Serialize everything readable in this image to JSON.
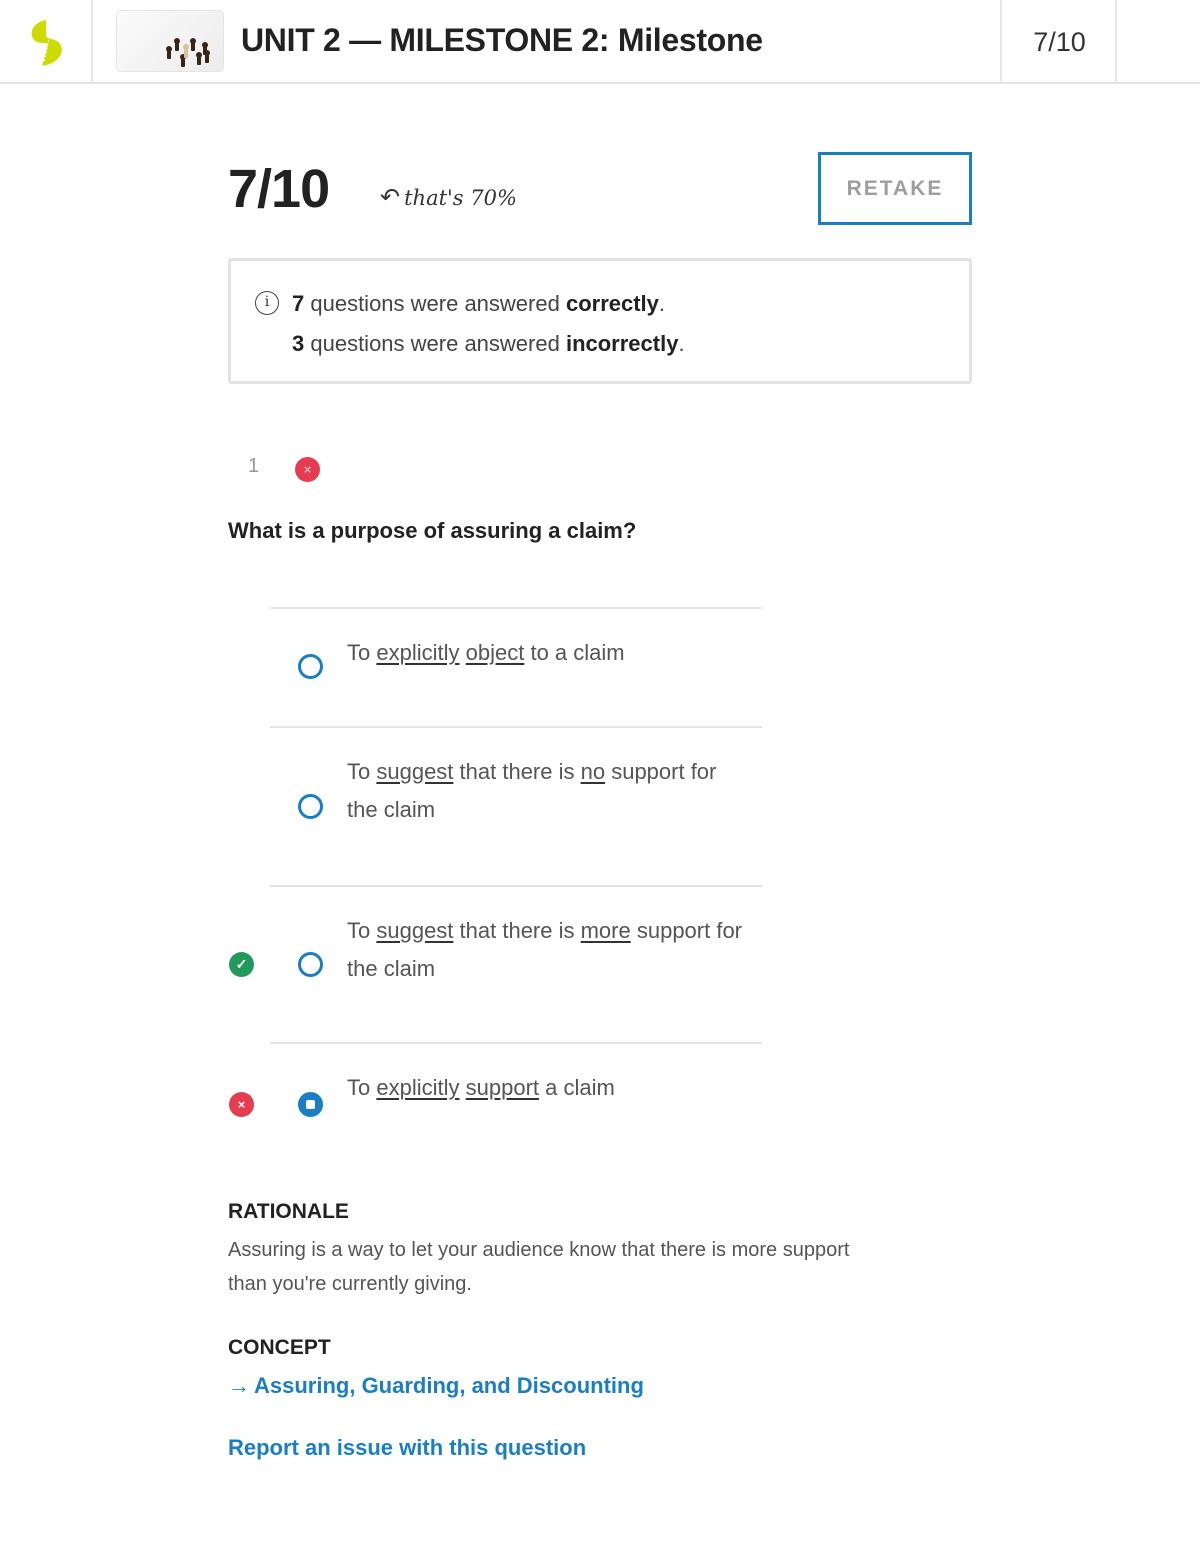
{
  "header": {
    "title": "UNIT 2 — MILESTONE 2: Milestone",
    "score": "7/10",
    "logo_color": "#cddc00",
    "thumbnail": "chess-pawns-thumbnail"
  },
  "result": {
    "score": "7/10",
    "note_arrow": "↶",
    "note": "that's 70%",
    "percent": 70,
    "retake_label": "RETAKE"
  },
  "summary": {
    "correct_count": "7",
    "correct_text": " questions were answered ",
    "correct_word": "correctly",
    "incorrect_count": "3",
    "incorrect_text": " questions were answered ",
    "incorrect_word": "incorrectly",
    "period": "."
  },
  "question": {
    "number": "1",
    "status": "incorrect",
    "text": "What is a purpose of assuring a claim?",
    "options": [
      {
        "parts": [
          {
            "t": "To ",
            "u": false
          },
          {
            "t": "explicitly",
            "u": true
          },
          {
            "t": " ",
            "u": false
          },
          {
            "t": "object",
            "u": true
          },
          {
            "t": " to a claim",
            "u": false
          }
        ],
        "selected": false,
        "marker": null
      },
      {
        "parts": [
          {
            "t": "To ",
            "u": false
          },
          {
            "t": "suggest",
            "u": true
          },
          {
            "t": " that there is ",
            "u": false
          },
          {
            "t": "no",
            "u": true
          },
          {
            "t": " support for the claim",
            "u": false
          }
        ],
        "selected": false,
        "marker": null
      },
      {
        "parts": [
          {
            "t": "To ",
            "u": false
          },
          {
            "t": "suggest",
            "u": true
          },
          {
            "t": " that there is ",
            "u": false
          },
          {
            "t": "more",
            "u": true
          },
          {
            "t": " support for the claim",
            "u": false
          }
        ],
        "selected": false,
        "marker": "correct"
      },
      {
        "parts": [
          {
            "t": "To ",
            "u": false
          },
          {
            "t": "explicitly",
            "u": true
          },
          {
            "t": " ",
            "u": false
          },
          {
            "t": "support",
            "u": true
          },
          {
            "t": " a claim",
            "u": false
          }
        ],
        "selected": true,
        "marker": "incorrect"
      }
    ]
  },
  "rationale": {
    "title": "RATIONALE",
    "text": "Assuring is a way to let your audience know that there is more support than you're currently giving."
  },
  "concept": {
    "title": "CONCEPT",
    "arrow": "→",
    "link": "Assuring, Guarding, and Discounting"
  },
  "report_link": "Report an issue with this question",
  "colors": {
    "accent": "#1a7ec2",
    "correct": "#1f9a5a",
    "incorrect": "#e63c50"
  },
  "icons": {
    "incorrect": "×",
    "correct": "✓",
    "info": "i"
  }
}
